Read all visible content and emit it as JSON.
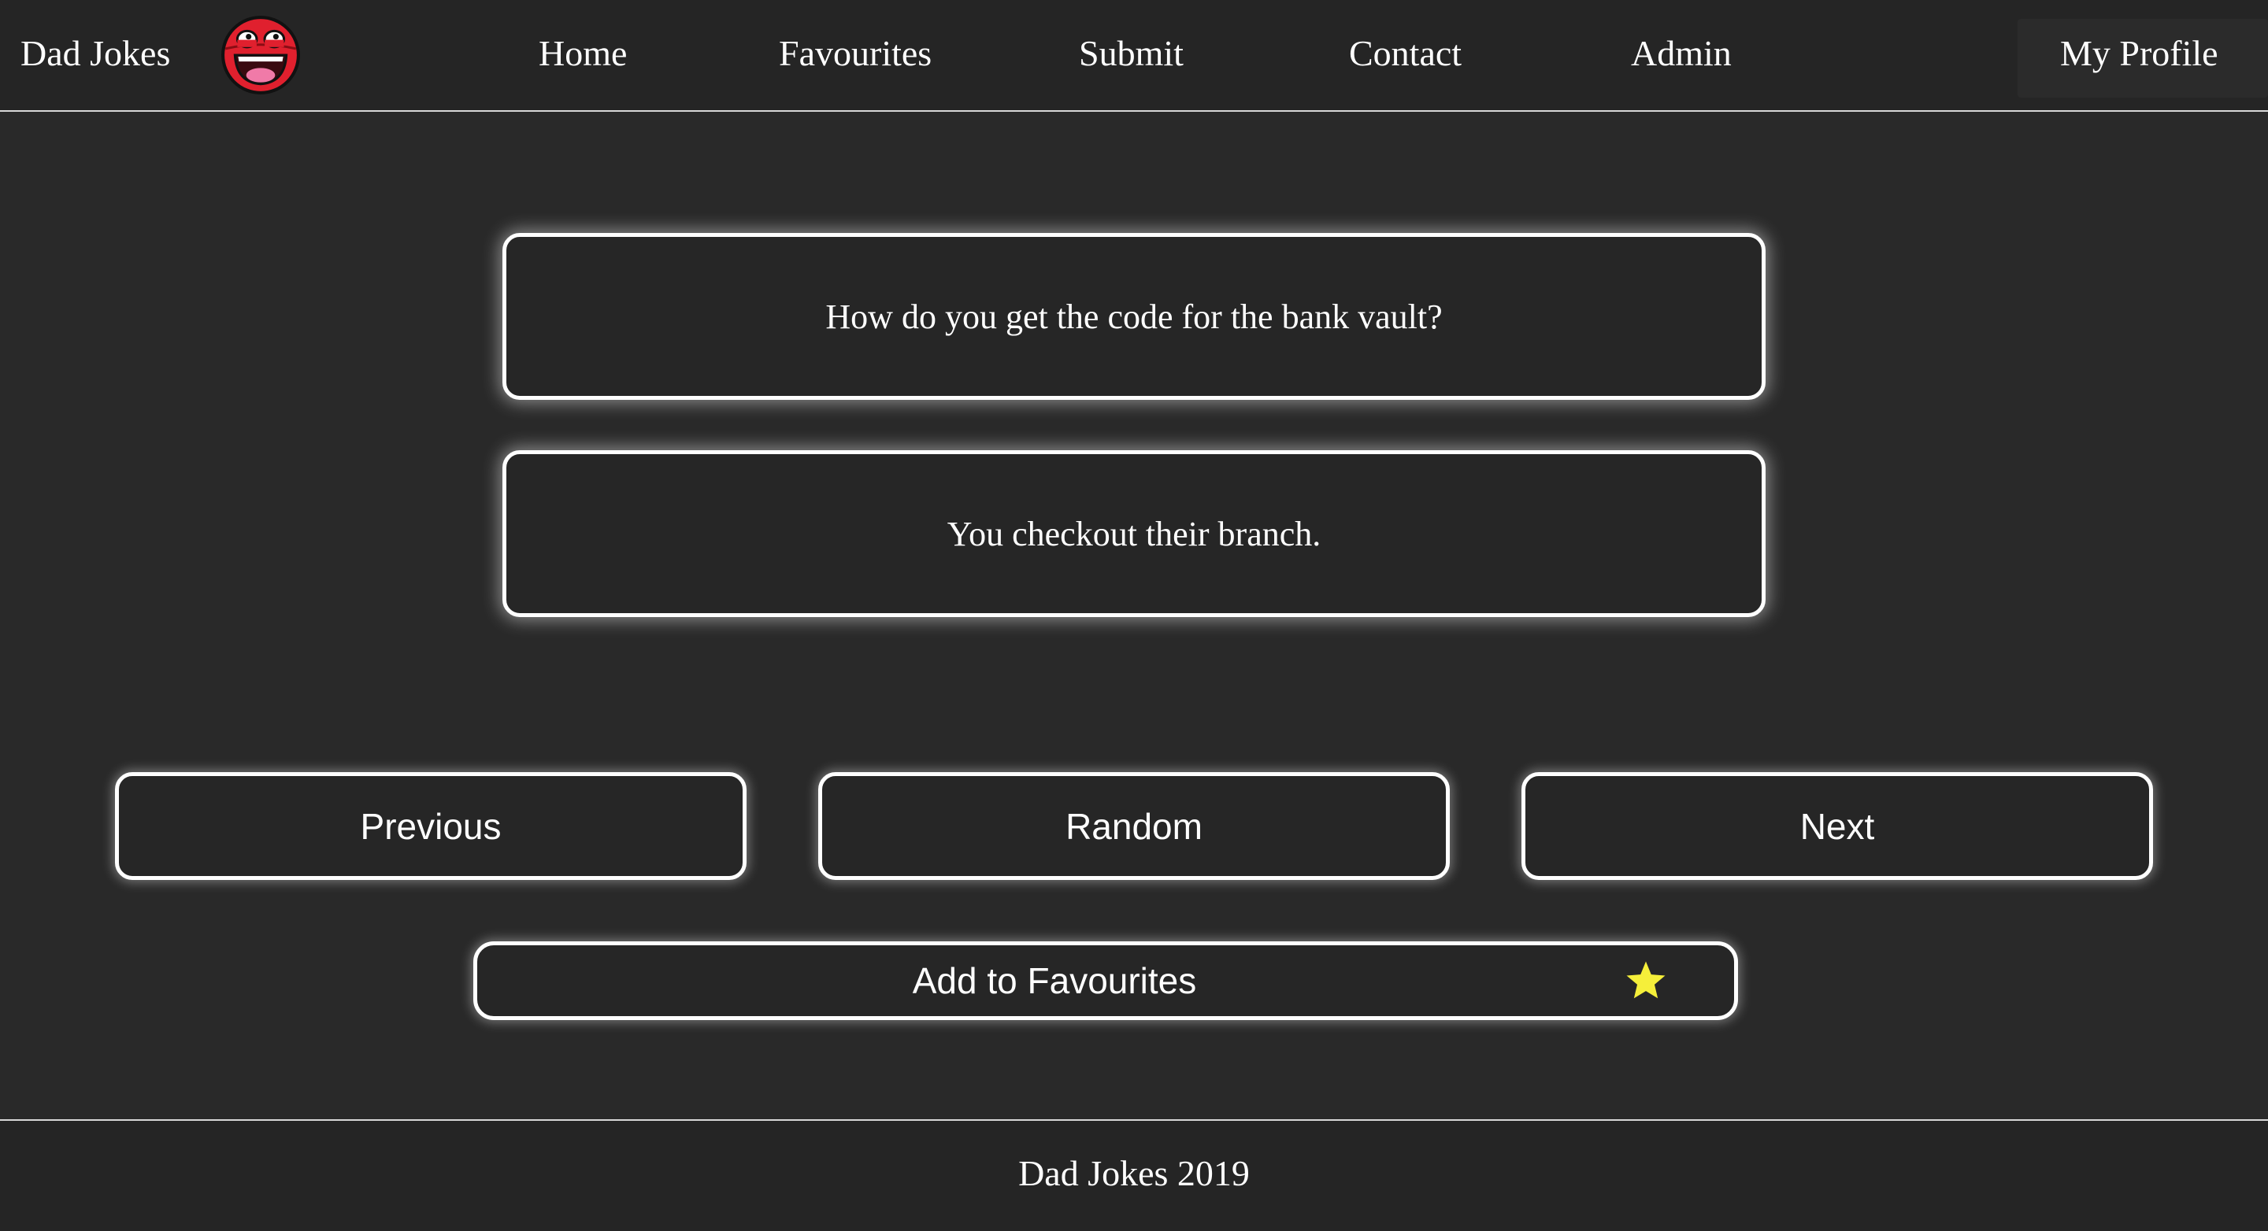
{
  "header": {
    "brand": "Dad Jokes",
    "logo_icon": "grinning-face-logo-icon",
    "nav": {
      "home": "Home",
      "favourites": "Favourites",
      "submit": "Submit",
      "contact": "Contact",
      "admin": "Admin"
    },
    "profile": "My Profile"
  },
  "joke": {
    "question": "How do you get the code for the bank vault?",
    "answer": "You checkout their branch."
  },
  "controls": {
    "previous": "Previous",
    "random": "Random",
    "next": "Next",
    "add_favourite": "Add to Favourites",
    "favourite_icon": "star-icon"
  },
  "footer": {
    "text": "Dad Jokes 2019"
  },
  "colors": {
    "background": "#292929",
    "border": "#ffffff",
    "star": "#f5ef3a",
    "logo_red": "#e0202e"
  }
}
